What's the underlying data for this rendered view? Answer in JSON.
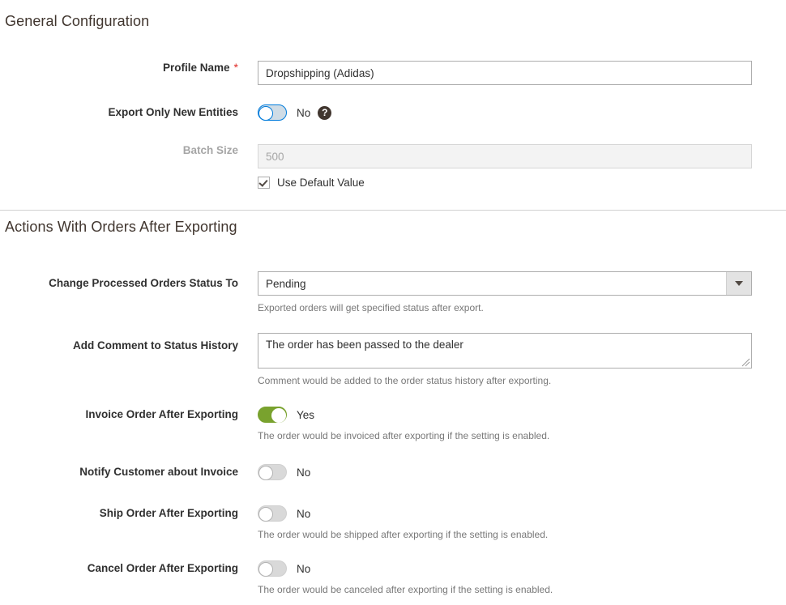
{
  "sections": [
    {
      "id": "general",
      "title": "General Configuration",
      "fields": [
        {
          "label": "Profile Name",
          "required": true,
          "type": "text",
          "value": "Dropshipping (Adidas)",
          "placeholder": ""
        },
        {
          "label": "Export Only New Entities",
          "type": "toggle",
          "state": "off-focus",
          "state_text": "No",
          "help_icon": "question-mark-icon",
          "help_glyph": "?"
        },
        {
          "label": "Batch Size",
          "type": "text",
          "disabled": true,
          "value": "500",
          "checkbox": {
            "label": "Use Default Value",
            "checked": true
          }
        }
      ]
    },
    {
      "id": "actions",
      "title": "Actions With Orders After Exporting",
      "fields": [
        {
          "label": "Change Processed Orders Status To",
          "type": "select",
          "value": "Pending",
          "options": [
            "Pending"
          ],
          "note": "Exported orders will get specified status after export."
        },
        {
          "label": "Add Comment to Status History",
          "type": "textarea",
          "value": "The order has been passed to the dealer",
          "note": "Comment would be added to the order status history after exporting."
        },
        {
          "label": "Invoice Order After Exporting",
          "type": "toggle",
          "state": "on",
          "state_text": "Yes",
          "note": "The order would be invoiced after exporting if the setting is enabled."
        },
        {
          "label": "Notify Customer about Invoice",
          "type": "toggle",
          "state": "off",
          "state_text": "No",
          "note": ""
        },
        {
          "label": "Ship Order After Exporting",
          "type": "toggle",
          "state": "off",
          "state_text": "No",
          "note": "The order would be shipped after exporting if the setting is enabled."
        },
        {
          "label": "Cancel Order After Exporting",
          "type": "toggle",
          "state": "off",
          "state_text": "No",
          "note": "The order would be canceled after exporting if the setting is enabled."
        }
      ]
    }
  ],
  "colors": {
    "toggle_on": "#79a22e",
    "toggle_focus_border": "#007bdb",
    "required_asterisk": "#e02b27",
    "heading": "#41362f",
    "note_text": "#787878"
  }
}
